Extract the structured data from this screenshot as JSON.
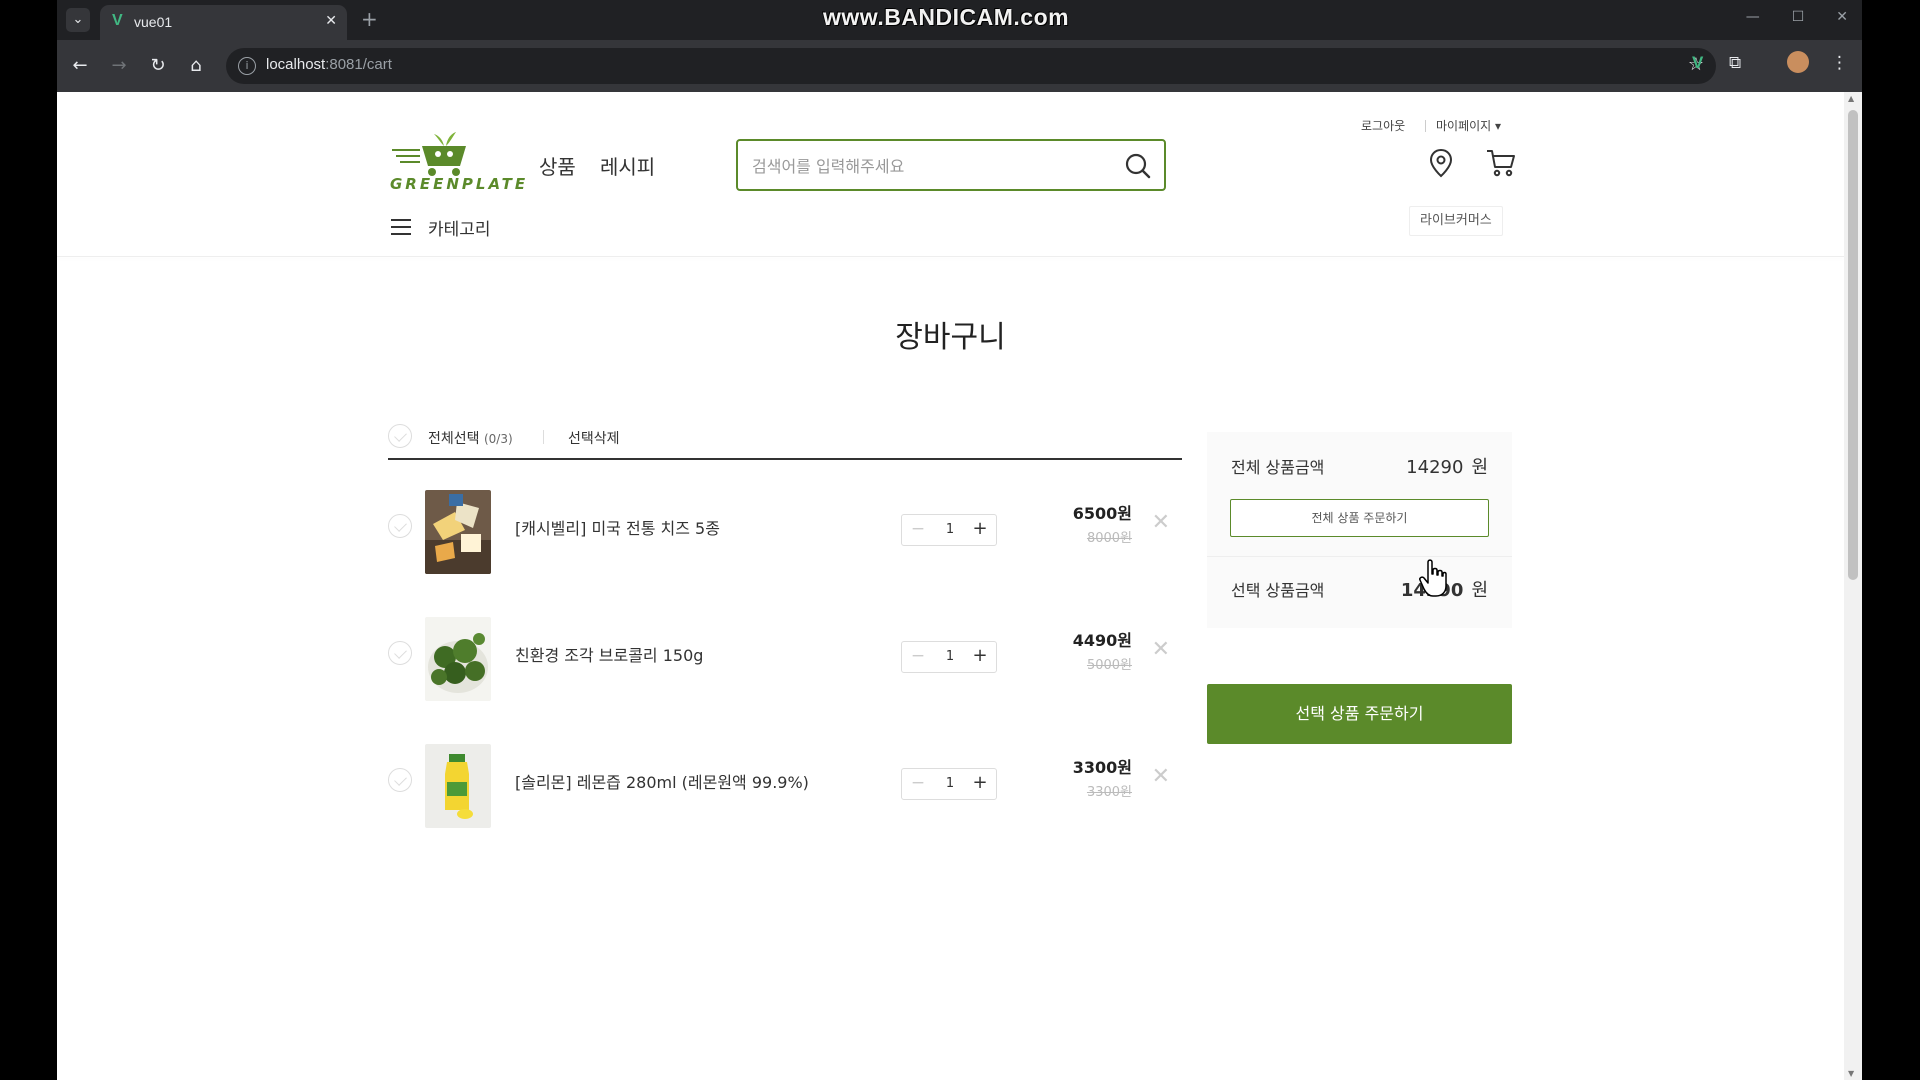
{
  "browser": {
    "tab_title": "vue01",
    "tab_menu_icon": "chevron-down-icon",
    "url_host": "localhost",
    "url_rest": ":8081/cart",
    "watermark": "www.BANDICAM.com"
  },
  "header": {
    "logo_text": "GREENPLATE",
    "nav": [
      "상품",
      "레시피"
    ],
    "search_placeholder": "검색어를 입력해주세요",
    "logout": "로그아웃",
    "mypage": "마이페이지 ▾",
    "category_label": "카테고리",
    "live_commerce": "라이브커머스"
  },
  "page": {
    "title": "장바구니"
  },
  "cart": {
    "select_all_label": "전체선택",
    "select_all_count": "(0/3)",
    "delete_selected_label": "선택삭제",
    "items": [
      {
        "name": "[캐시벨리] 미국 전통 치즈 5종",
        "qty": "1",
        "price": "6500원",
        "original_price": "8000원"
      },
      {
        "name": "친환경 조각 브로콜리 150g",
        "qty": "1",
        "price": "4490원",
        "original_price": "5000원"
      },
      {
        "name": "[솔리몬] 레몬즙 280ml (레몬원액 99.9%)",
        "qty": "1",
        "price": "3300원",
        "original_price": "3300원"
      }
    ]
  },
  "summary": {
    "total_label": "전체 상품금액",
    "total_value": "14290",
    "currency": "원",
    "order_all_label": "전체 상품 주문하기",
    "selected_label": "선택 상품금액",
    "selected_value": "14290",
    "order_selected_label": "선택 상품 주문하기"
  },
  "colors": {
    "brand_green": "#5b8a2a",
    "tab_favicon": "#41b883"
  }
}
